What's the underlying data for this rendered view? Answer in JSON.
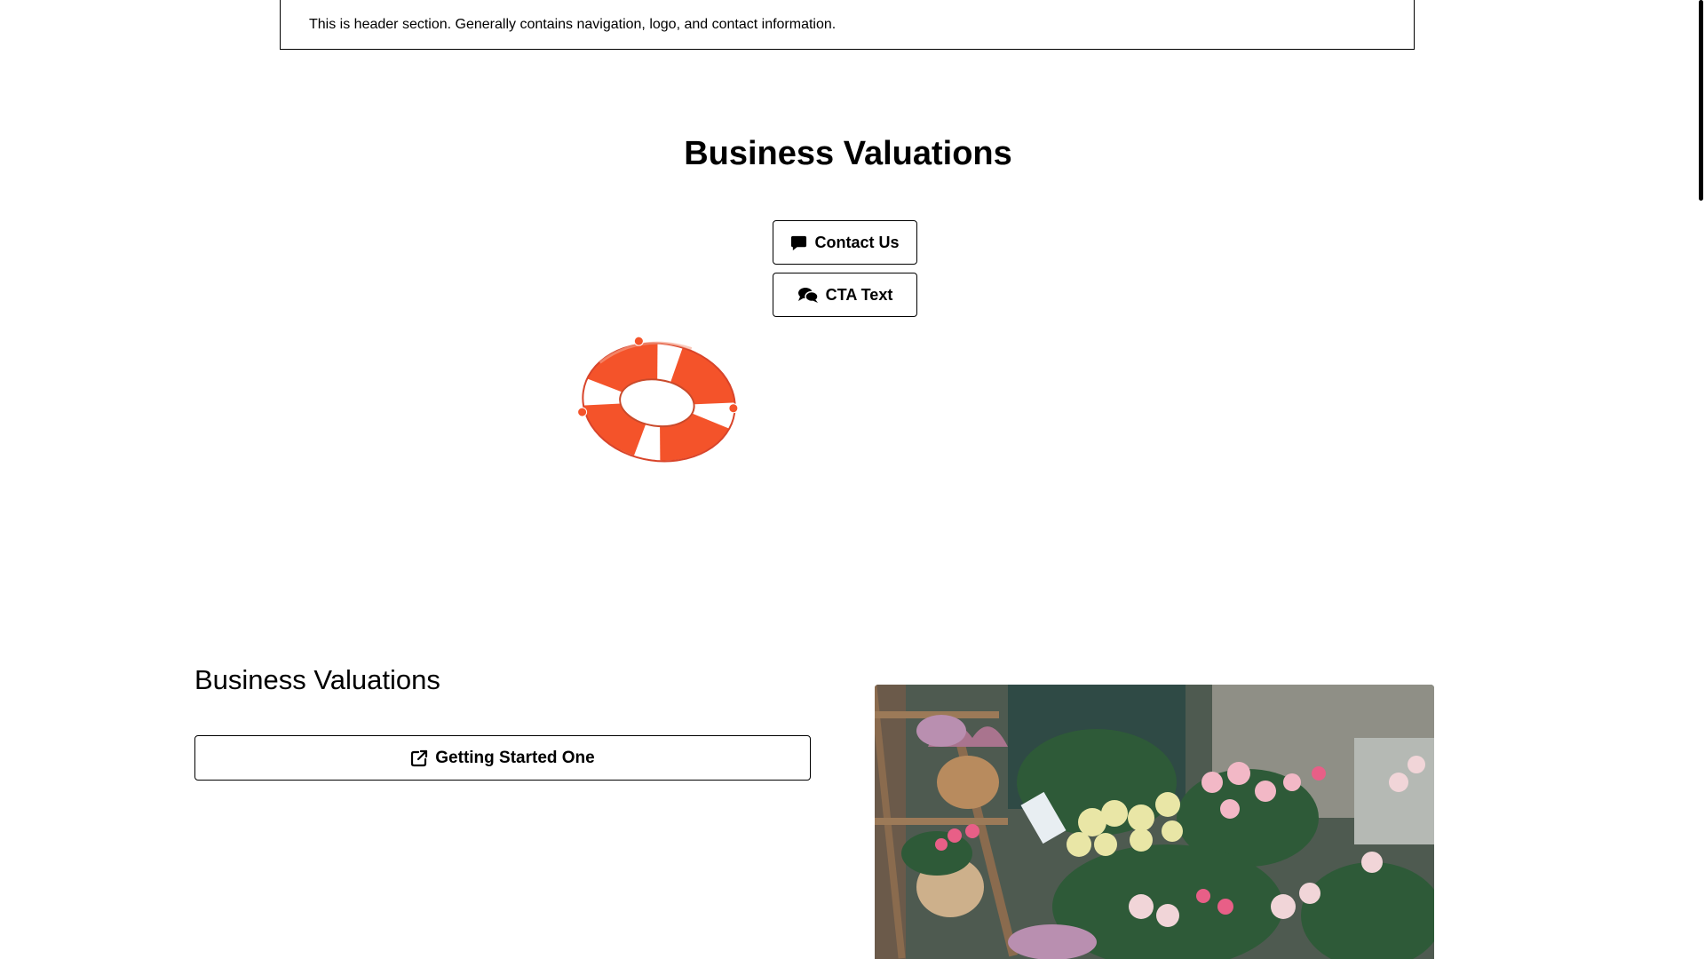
{
  "header": {
    "text": "This is header section. Generally contains navigation, logo, and contact information."
  },
  "hero": {
    "title": "Business Valuations",
    "contact_button": {
      "label": "Contact Us",
      "icon": "chat-bubble-icon"
    },
    "cta_button": {
      "label": "CTA Text",
      "icon": "chat-bubbles-icon"
    },
    "image_icon": "lifebuoy-icon"
  },
  "section": {
    "title": "Business Valuations",
    "start_button": {
      "label": "Getting Started One",
      "icon": "external-link-icon"
    },
    "image": "flower-shop-photo"
  },
  "colors": {
    "lifebuoy_red": "#f4532a",
    "border": "#000000",
    "background": "#ffffff"
  }
}
